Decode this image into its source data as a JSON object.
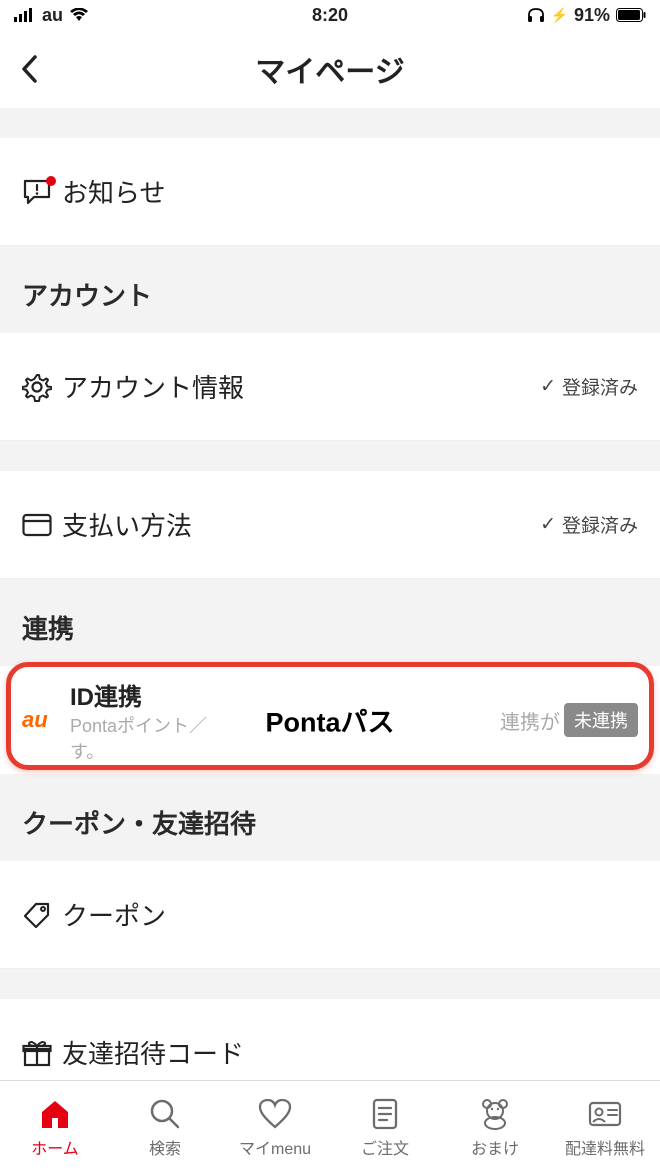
{
  "status": {
    "carrier": "au",
    "time": "8:20",
    "battery": "91%"
  },
  "header": {
    "title": "マイページ"
  },
  "notifications": {
    "label": "お知らせ"
  },
  "sections": {
    "account": {
      "header": "アカウント",
      "items": {
        "info": {
          "label": "アカウント情報",
          "status": "登録済み"
        },
        "payment": {
          "label": "支払い方法",
          "status": "登録済み"
        }
      }
    },
    "link": {
      "header": "連携",
      "au": {
        "logo": "au",
        "title": "ID連携",
        "sub1": "Pontaポイント／",
        "sub2": "す。",
        "right_text": "連携が",
        "badge": "未連携",
        "overlay": "Pontaパス"
      }
    },
    "coupon": {
      "header": "クーポン・友達招待",
      "items": {
        "coupon": {
          "label": "クーポン"
        },
        "invite": {
          "label": "友達招待コード"
        }
      }
    }
  },
  "tabs": {
    "home": "ホーム",
    "search": "検索",
    "mymenu": "マイmenu",
    "order": "ご注文",
    "bonus": "おまけ",
    "freeship": "配達料無料"
  }
}
